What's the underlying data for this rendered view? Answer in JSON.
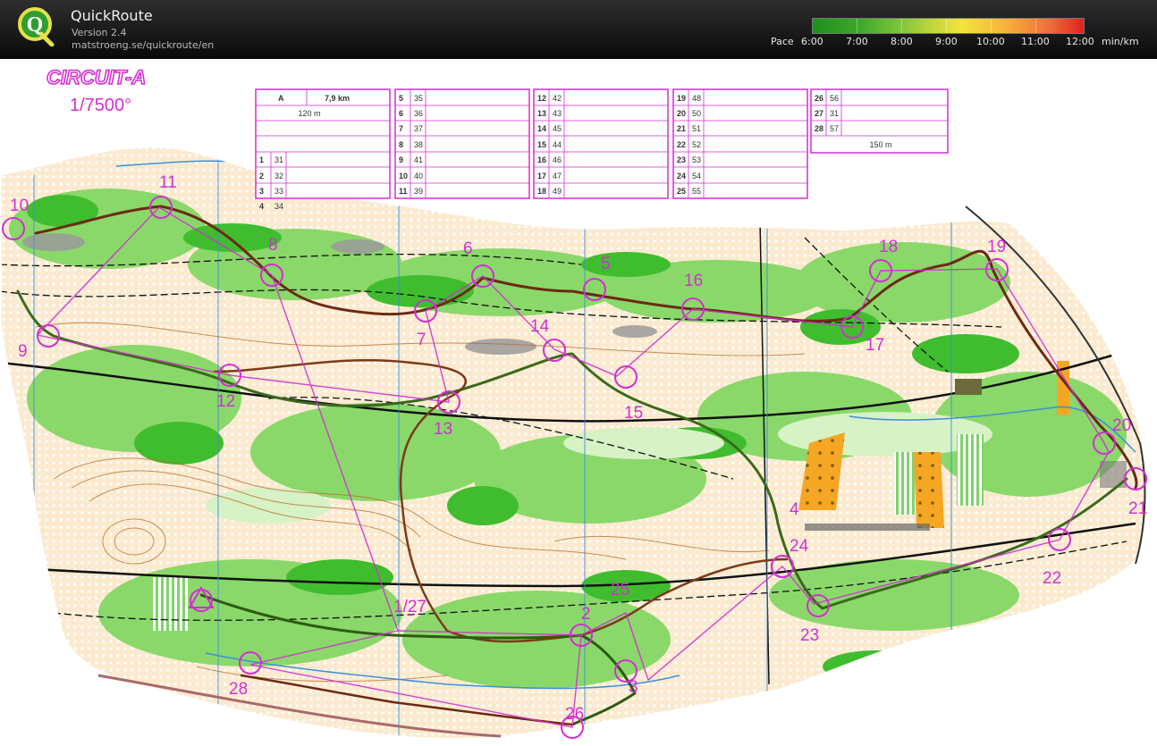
{
  "app": {
    "name": "QuickRoute",
    "version": "Version 2.4",
    "url": "matstroeng.se/quickroute/en",
    "logo_letter": "Q"
  },
  "pace_legend": {
    "label": "Pace",
    "ticks": [
      "6:00",
      "7:00",
      "8:00",
      "9:00",
      "10:00",
      "11:00",
      "12:00"
    ],
    "unit": "min/km",
    "colors": [
      "#1e8f1e",
      "#7cc43a",
      "#f4e43a",
      "#f06a3a",
      "#e02020"
    ]
  },
  "map": {
    "title": "CIRCUIT-A",
    "scale": "1/7500°",
    "course_color": "#d22fd2",
    "route_color": "#7a2a1a",
    "controls": [
      {
        "label": "1/27"
      },
      {
        "label": "2"
      },
      {
        "label": "3"
      },
      {
        "label": "4"
      },
      {
        "label": "5"
      },
      {
        "label": "6"
      },
      {
        "label": "7"
      },
      {
        "label": "8"
      },
      {
        "label": "9"
      },
      {
        "label": "10"
      },
      {
        "label": "11"
      },
      {
        "label": "12"
      },
      {
        "label": "13"
      },
      {
        "label": "14"
      },
      {
        "label": "15"
      },
      {
        "label": "16"
      },
      {
        "label": "17"
      },
      {
        "label": "18"
      },
      {
        "label": "19"
      },
      {
        "label": "20"
      },
      {
        "label": "21"
      },
      {
        "label": "22"
      },
      {
        "label": "23"
      },
      {
        "label": "24"
      },
      {
        "label": "25"
      },
      {
        "label": "26"
      },
      {
        "label": "28"
      }
    ]
  },
  "description_sheet": {
    "course": "A",
    "length": "7,9 km",
    "start_distance": "120 m",
    "finish_distance": "150 m",
    "rows": [
      [
        "1",
        "31"
      ],
      [
        "2",
        "32"
      ],
      [
        "3",
        "33"
      ],
      [
        "4",
        "34"
      ],
      [
        "5",
        "35"
      ],
      [
        "6",
        "36"
      ],
      [
        "7",
        "37"
      ],
      [
        "8",
        "38"
      ],
      [
        "9",
        "41"
      ],
      [
        "10",
        "40"
      ],
      [
        "11",
        "39"
      ],
      [
        "12",
        "42"
      ],
      [
        "13",
        "43"
      ],
      [
        "14",
        "45"
      ],
      [
        "15",
        "44"
      ],
      [
        "16",
        "46"
      ],
      [
        "17",
        "47"
      ],
      [
        "18",
        "49"
      ],
      [
        "19",
        "48"
      ],
      [
        "20",
        "50"
      ],
      [
        "21",
        "51"
      ],
      [
        "22",
        "52"
      ],
      [
        "23",
        "53"
      ],
      [
        "24",
        "54"
      ],
      [
        "25",
        "55"
      ],
      [
        "26",
        "56"
      ],
      [
        "27",
        "31"
      ],
      [
        "28",
        "57"
      ]
    ]
  }
}
